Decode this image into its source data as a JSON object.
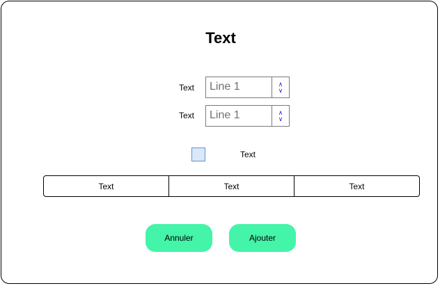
{
  "dialog": {
    "title": "Text",
    "fields": [
      {
        "label": "Text",
        "value": "Line 1",
        "up": "∧",
        "down": "∨"
      },
      {
        "label": "Text",
        "value": "Line 1",
        "up": "∧",
        "down": "∨"
      }
    ],
    "checkbox": {
      "label": "Text",
      "checked": false,
      "fill": "#dae8fc",
      "stroke": "#6c8ebf"
    },
    "tabs": [
      "Text",
      "Text",
      "Text"
    ],
    "buttons": {
      "cancel_label": "Annuler",
      "add_label": "Ajouter",
      "color": "#44f4a8"
    }
  }
}
